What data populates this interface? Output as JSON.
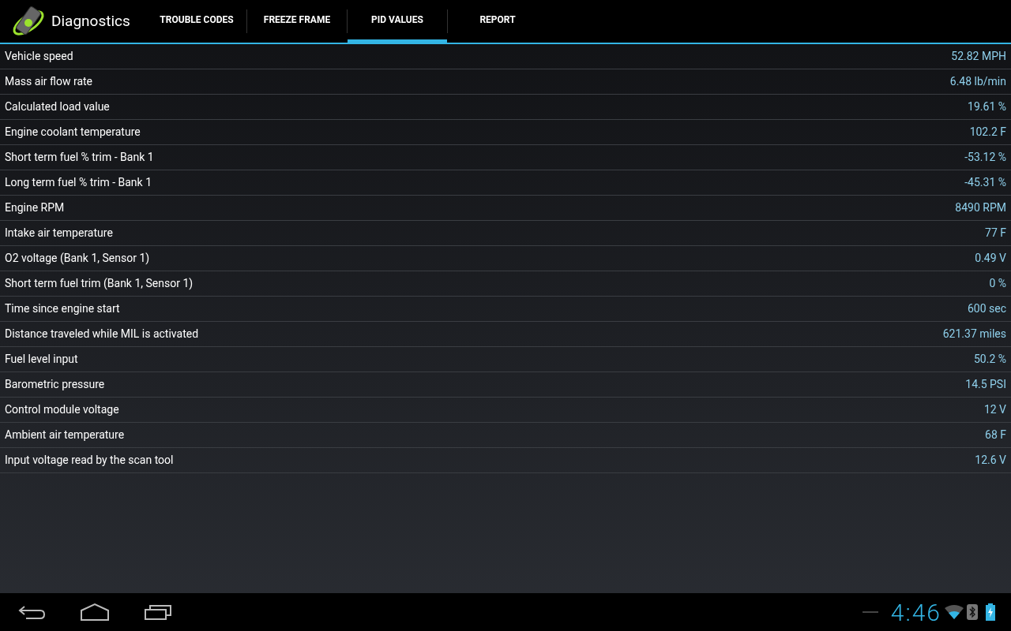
{
  "app_bar": {
    "title": "Diagnostics"
  },
  "tabs": [
    {
      "label": "TROUBLE CODES",
      "selected": false
    },
    {
      "label": "FREEZE FRAME",
      "selected": false
    },
    {
      "label": "PID VALUES",
      "selected": true
    },
    {
      "label": "REPORT",
      "selected": false
    }
  ],
  "pid_rows": [
    {
      "name": "Vehicle speed",
      "value": "52.82 MPH"
    },
    {
      "name": "Mass air flow rate",
      "value": "6.48 lb/min"
    },
    {
      "name": "Calculated load value",
      "value": "19.61 %"
    },
    {
      "name": "Engine coolant temperature",
      "value": "102.2 F"
    },
    {
      "name": "Short term fuel % trim - Bank 1",
      "value": "-53.12 %"
    },
    {
      "name": "Long term fuel % trim - Bank 1",
      "value": "-45.31 %"
    },
    {
      "name": "Engine RPM",
      "value": "8490 RPM"
    },
    {
      "name": "Intake air temperature",
      "value": "77 F"
    },
    {
      "name": "O2 voltage (Bank 1, Sensor 1)",
      "value": "0.49 V"
    },
    {
      "name": "Short term fuel trim (Bank 1, Sensor 1)",
      "value": "0 %"
    },
    {
      "name": "Time since engine start",
      "value": "600 sec"
    },
    {
      "name": "Distance traveled while MIL is activated",
      "value": "621.37 miles"
    },
    {
      "name": "Fuel level input",
      "value": "50.2 %"
    },
    {
      "name": "Barometric pressure",
      "value": "14.5 PSI"
    },
    {
      "name": "Control module voltage",
      "value": "12 V"
    },
    {
      "name": "Ambient air temperature",
      "value": "68 F"
    },
    {
      "name": "Input voltage read by the scan tool",
      "value": "12.6 V"
    }
  ],
  "system_bar": {
    "clock": "4:46"
  }
}
